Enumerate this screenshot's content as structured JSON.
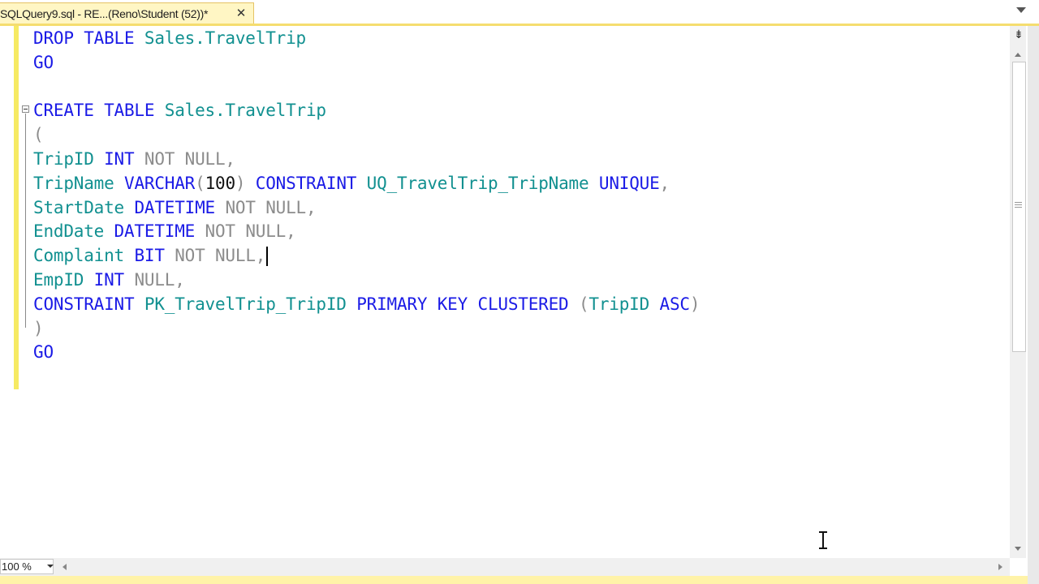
{
  "tab": {
    "title": "SQLQuery9.sql - RE...(Reno\\Student (52))*",
    "close_glyph": "✕"
  },
  "editor": {
    "lines": [
      [
        {
          "t": "DROP TABLE ",
          "c": "kw"
        },
        {
          "t": "Sales.TravelTrip",
          "c": "id"
        }
      ],
      [
        {
          "t": "GO",
          "c": "kw"
        }
      ],
      [],
      [
        {
          "t": "CREATE TABLE ",
          "c": "kw"
        },
        {
          "t": "Sales.TravelTrip",
          "c": "id"
        }
      ],
      [
        {
          "t": "(",
          "c": "gr"
        }
      ],
      [
        {
          "t": "TripID ",
          "c": "id"
        },
        {
          "t": "INT ",
          "c": "kw"
        },
        {
          "t": "NOT NULL,",
          "c": "gr"
        }
      ],
      [
        {
          "t": "TripName ",
          "c": "id"
        },
        {
          "t": "VARCHAR",
          "c": "kw"
        },
        {
          "t": "(",
          "c": "gr"
        },
        {
          "t": "100",
          "c": "bk"
        },
        {
          "t": ") ",
          "c": "gr"
        },
        {
          "t": "CONSTRAINT ",
          "c": "kw"
        },
        {
          "t": "UQ_TravelTrip_TripName ",
          "c": "id"
        },
        {
          "t": "UNIQUE",
          "c": "kw"
        },
        {
          "t": ",",
          "c": "gr"
        }
      ],
      [
        {
          "t": "StartDate ",
          "c": "id"
        },
        {
          "t": "DATETIME ",
          "c": "kw"
        },
        {
          "t": "NOT NULL,",
          "c": "gr"
        }
      ],
      [
        {
          "t": "EndDate ",
          "c": "id"
        },
        {
          "t": "DATETIME ",
          "c": "kw"
        },
        {
          "t": "NOT NULL,",
          "c": "gr"
        }
      ],
      [
        {
          "t": "Complaint ",
          "c": "id"
        },
        {
          "t": "BIT ",
          "c": "kw"
        },
        {
          "t": "NOT NULL,",
          "c": "gr"
        }
      ],
      [
        {
          "t": "EmpID ",
          "c": "id"
        },
        {
          "t": "INT ",
          "c": "kw"
        },
        {
          "t": "NULL,",
          "c": "gr"
        }
      ],
      [
        {
          "t": "CONSTRAINT ",
          "c": "kw"
        },
        {
          "t": "PK_TravelTrip_TripID ",
          "c": "id"
        },
        {
          "t": "PRIMARY KEY CLUSTERED ",
          "c": "kw"
        },
        {
          "t": "(",
          "c": "gr"
        },
        {
          "t": "TripID ",
          "c": "id"
        },
        {
          "t": "ASC",
          "c": "kw"
        },
        {
          "t": ")",
          "c": "gr"
        }
      ],
      [
        {
          "t": ")",
          "c": "gr"
        }
      ],
      [
        {
          "t": "GO",
          "c": "kw"
        }
      ]
    ],
    "caret_line": 9
  },
  "zoom": {
    "value": "100 %"
  },
  "icons": {
    "tab_close": "close-icon",
    "tab_menu": "chevron-down-icon",
    "split": "split-view-icon",
    "mouse": "text-cursor-icon"
  },
  "colors": {
    "keyword": "#1a1ae6",
    "identifier": "#119090",
    "operator": "#8c8c8c",
    "literal": "#111111",
    "tab_background": "#fff6c4",
    "change_margin": "#f6ea63"
  }
}
